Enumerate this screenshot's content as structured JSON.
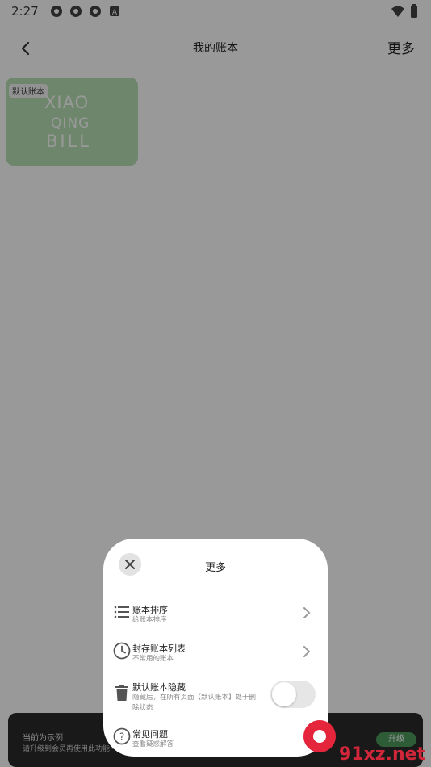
{
  "status_bar": {
    "time": "2:27"
  },
  "header": {
    "title": "我的账本",
    "more_label": "更多"
  },
  "book": {
    "tag": "默认账本",
    "logo_line1": "XIAO",
    "logo_line2": "QING",
    "logo_line3": "BILL",
    "color": "#b7dfb4"
  },
  "banner": {
    "title": "当前为示例",
    "subtitle": "请升级到会员再使用此功能~",
    "button": "升级"
  },
  "sheet": {
    "title": "更多",
    "items": [
      {
        "title": "账本排序",
        "subtitle": "给账本排序",
        "icon": "list-icon"
      },
      {
        "title": "封存账本列表",
        "subtitle": "不常用的账本",
        "icon": "clock-icon"
      },
      {
        "title": "默认账本隐藏",
        "subtitle": "隐藏后，在所有页面【默认账本】处于删除状态",
        "icon": "trash-icon"
      },
      {
        "title": "常见问题",
        "subtitle": "查看疑惑解答",
        "icon": "help-icon"
      }
    ]
  },
  "watermark": {
    "text": "91xz.net"
  }
}
